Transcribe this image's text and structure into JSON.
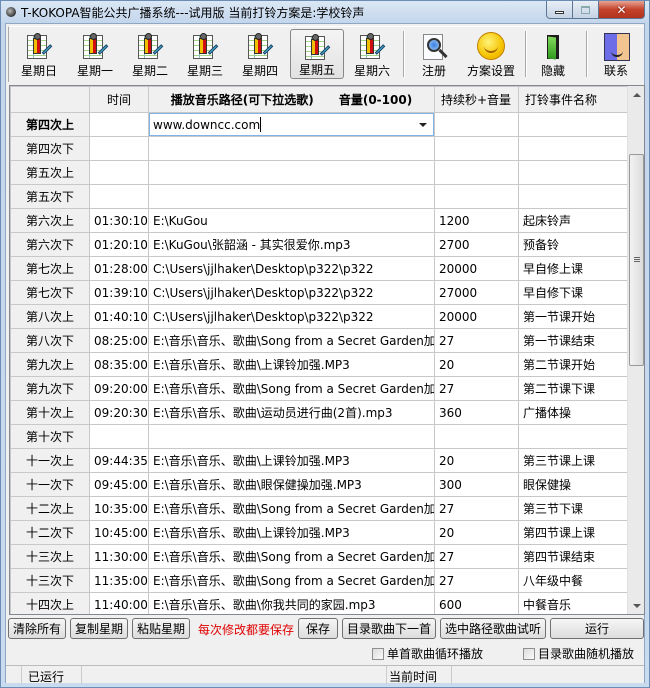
{
  "window": {
    "title": "T-KOKOPA智能公共广播系统---试用版  当前打铃方案是:学校铃声",
    "controls": {
      "minimize": "minimize",
      "maximize": "maximize",
      "close": "close"
    }
  },
  "toolbar": {
    "days": [
      {
        "label": "星期日",
        "icon": "schedule-sheet-icon",
        "selected": false
      },
      {
        "label": "星期一",
        "icon": "schedule-sheet-icon",
        "selected": false
      },
      {
        "label": "星期二",
        "icon": "schedule-sheet-icon",
        "selected": false
      },
      {
        "label": "星期三",
        "icon": "schedule-sheet-icon",
        "selected": false
      },
      {
        "label": "星期四",
        "icon": "schedule-sheet-icon",
        "selected": false
      },
      {
        "label": "星期五",
        "icon": "schedule-sheet-icon",
        "selected": true
      },
      {
        "label": "星期六",
        "icon": "schedule-sheet-icon",
        "selected": false
      }
    ],
    "register": {
      "label": "注册",
      "icon": "magnifier-document-icon"
    },
    "scheme_settings": {
      "label": "方案设置",
      "icon": "smiley-icon"
    },
    "hide": {
      "label": "隐藏",
      "icon": "door-icon"
    },
    "contact": {
      "label": "联系",
      "icon": "finder-face-icon"
    }
  },
  "grid": {
    "headers": {
      "row_header": "",
      "time": "时间",
      "path": "播放音乐路径(可下拉选歌)      音量(0-100)",
      "duration": "持续秒+音量",
      "event": "打铃事件名称"
    },
    "editing_value": "www.downcc.com",
    "rows": [
      {
        "label": "第四次上",
        "time": "",
        "path": "",
        "duration": "",
        "event": "",
        "current": true
      },
      {
        "label": "第四次下",
        "time": "",
        "path": "",
        "duration": "",
        "event": ""
      },
      {
        "label": "第五次上",
        "time": "",
        "path": "",
        "duration": "",
        "event": ""
      },
      {
        "label": "第五次下",
        "time": "",
        "path": "",
        "duration": "",
        "event": ""
      },
      {
        "label": "第六次上",
        "time": "01:30:10",
        "path": "E:\\KuGou",
        "duration": "1200",
        "event": "起床铃声"
      },
      {
        "label": "第六次下",
        "time": "01:20:10",
        "path": "E:\\KuGou\\张韶涵 - 其实很爱你.mp3",
        "duration": "2700",
        "event": "预备铃"
      },
      {
        "label": "第七次上",
        "time": "01:28:00",
        "path": "C:\\Users\\jjlhaker\\Desktop\\p322\\p322",
        "duration": "20000",
        "event": "早自修上课"
      },
      {
        "label": "第七次下",
        "time": "01:39:10",
        "path": "C:\\Users\\jjlhaker\\Desktop\\p322\\p322",
        "duration": "27000",
        "event": "早自修下课"
      },
      {
        "label": "第八次上",
        "time": "01:40:10",
        "path": "C:\\Users\\jjlhaker\\Desktop\\p322\\p322",
        "duration": "20000",
        "event": "第一节课开始"
      },
      {
        "label": "第八次下",
        "time": "08:25:00",
        "path": "E:\\音乐\\音乐、歌曲\\Song from a Secret Garden加",
        "duration": "27",
        "event": "第一节课结束"
      },
      {
        "label": "第九次上",
        "time": "08:35:00",
        "path": "E:\\音乐\\音乐、歌曲\\上课铃加强.MP3",
        "duration": "20",
        "event": "第二节课开始"
      },
      {
        "label": "第九次下",
        "time": "09:20:00",
        "path": "E:\\音乐\\音乐、歌曲\\Song from a Secret Garden加",
        "duration": "27",
        "event": "第二节课下课"
      },
      {
        "label": "第十次上",
        "time": "09:20:30",
        "path": "E:\\音乐\\音乐、歌曲\\运动员进行曲(2首).mp3",
        "duration": "360",
        "event": "广播体操"
      },
      {
        "label": "第十次下",
        "time": "",
        "path": "",
        "duration": "",
        "event": ""
      },
      {
        "label": "十一次上",
        "time": "09:44:35",
        "path": "E:\\音乐\\音乐、歌曲\\上课铃加强.MP3",
        "duration": "20",
        "event": "第三节课上课"
      },
      {
        "label": "十一次下",
        "time": "09:45:00",
        "path": "E:\\音乐\\音乐、歌曲\\眼保健操加强.MP3",
        "duration": "300",
        "event": "眼保健操"
      },
      {
        "label": "十二次上",
        "time": "10:35:00",
        "path": "E:\\音乐\\音乐、歌曲\\Song from a Secret Garden加",
        "duration": "27",
        "event": "第三节下课"
      },
      {
        "label": "十二次下",
        "time": "10:45:00",
        "path": "E:\\音乐\\音乐、歌曲\\上课铃加强.MP3",
        "duration": "20",
        "event": "第四节课上课"
      },
      {
        "label": "十三次上",
        "time": "11:30:00",
        "path": "E:\\音乐\\音乐、歌曲\\Song from a Secret Garden加",
        "duration": "27",
        "event": "第四节课结束"
      },
      {
        "label": "十三次下",
        "time": "11:35:00",
        "path": "E:\\音乐\\音乐、歌曲\\Song from a Secret Garden加",
        "duration": "27",
        "event": "八年级中餐"
      },
      {
        "label": "十四次上",
        "time": "11:40:00",
        "path": "E:\\音乐\\音乐、歌曲\\你我共同的家园.mp3",
        "duration": "600",
        "event": "中餐音乐"
      },
      {
        "label": "",
        "time": "",
        "path": "",
        "duration": "",
        "event": ""
      }
    ],
    "scroll_position_fraction": 0.18
  },
  "buttons": {
    "clear_all": "清除所有",
    "copy_day": "复制星期",
    "paste_day": "粘贴星期",
    "save_hint": "每次修改都要保存",
    "save": "保存",
    "next_in_dir": "目录歌曲下一首",
    "preview_selected": "选中路径歌曲试听",
    "run": "运行"
  },
  "options": {
    "loop_single": {
      "label": "单首歌曲循环播放",
      "checked": false
    },
    "shuffle_dir": {
      "label": "目录歌曲随机播放",
      "checked": false
    }
  },
  "status": {
    "run_state": "已运行",
    "current_time_label": "当前时间"
  }
}
